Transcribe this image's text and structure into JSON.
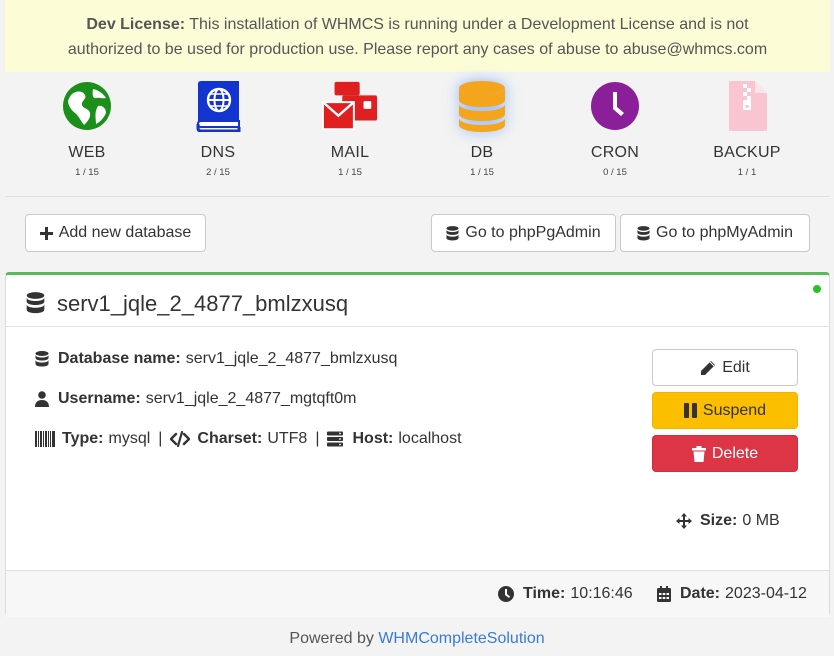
{
  "banner": {
    "bold": "Dev License:",
    "line1": " This installation of WHMCS is running under a Development License and is not",
    "line2": "authorized to be used for production use. Please report any cases of abuse to abuse@whmcs.com"
  },
  "modules": [
    {
      "label": "WEB",
      "count": "1 / 15",
      "icon": "globe-icon",
      "color": "#1a8f1a"
    },
    {
      "label": "DNS",
      "count": "2 / 15",
      "icon": "dns-book-icon",
      "color": "#1334cf"
    },
    {
      "label": "MAIL",
      "count": "1 / 15",
      "icon": "mail-icon",
      "color": "#e02020"
    },
    {
      "label": "DB",
      "count": "1 / 15",
      "icon": "database-icon",
      "color": "#f5a51c"
    },
    {
      "label": "CRON",
      "count": "0 / 15",
      "icon": "clock-icon",
      "color": "#8b1f9a"
    },
    {
      "label": "BACKUP",
      "count": "1 / 1",
      "icon": "archive-file-icon",
      "color": "#f9c5d1"
    }
  ],
  "toolbar": {
    "add_label": "Add new database",
    "pgadmin_label": "Go to phpPgAdmin",
    "myadmin_label": "Go to phpMyAdmin"
  },
  "database": {
    "title": "serv1_jqle_2_4877_bmlzxusq",
    "name_label": "Database name:",
    "name_value": "serv1_jqle_2_4877_bmlzxusq",
    "username_label": "Username:",
    "username_value": "serv1_jqle_2_4877_mgtqft0m",
    "type_label": "Type:",
    "type_value": "mysql",
    "charset_label": "Charset:",
    "charset_value": "UTF8",
    "host_label": "Host:",
    "host_value": "localhost",
    "separator": "|",
    "size_label": "Size:",
    "size_value": "0 MB"
  },
  "actions": {
    "edit": "Edit",
    "suspend": "Suspend",
    "delete": "Delete"
  },
  "footer": {
    "time_label": "Time:",
    "time_value": "10:16:46",
    "date_label": "Date:",
    "date_value": "2023-04-12"
  },
  "powered": {
    "text": "Powered by ",
    "link": "WHMCompleteSolution"
  },
  "colors": {
    "accent_green": "#5cb85c",
    "status_online": "#28c228",
    "warning": "#fbbf00",
    "danger": "#dd3545",
    "link": "#3a7bd5"
  }
}
